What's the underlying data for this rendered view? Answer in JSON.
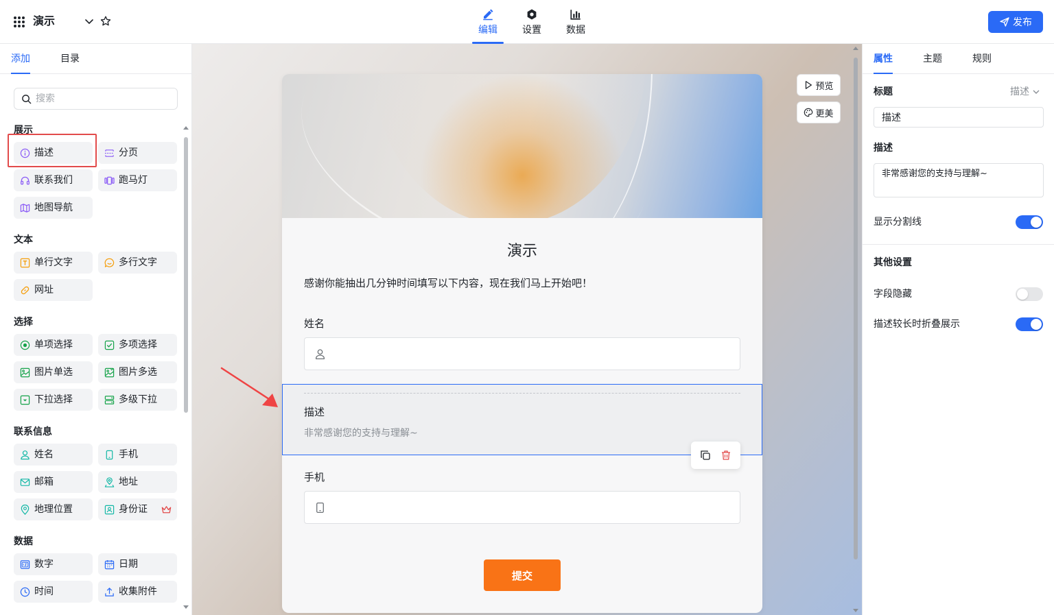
{
  "header": {
    "app_title": "演示",
    "tabs": [
      {
        "label": "编辑",
        "icon": "pencil-icon",
        "active": true
      },
      {
        "label": "设置",
        "icon": "gear-icon",
        "active": false
      },
      {
        "label": "数据",
        "icon": "bar-chart-icon",
        "active": false
      }
    ],
    "publish_label": "发布"
  },
  "left": {
    "tabs": [
      "添加",
      "目录"
    ],
    "search_placeholder": "搜索",
    "sections": {
      "display": "展示",
      "text": "文本",
      "choice": "选择",
      "contact": "联系信息",
      "data": "数据"
    },
    "items": {
      "describe": "描述",
      "pagination": "分页",
      "contact_us": "联系我们",
      "marquee": "跑马灯",
      "map_nav": "地图导航",
      "single_text": "单行文字",
      "multi_text": "多行文字",
      "url": "网址",
      "single_choice": "单项选择",
      "multi_choice": "多项选择",
      "image_single": "图片单选",
      "image_multi": "图片多选",
      "dropdown": "下拉选择",
      "cascade": "多级下拉",
      "name": "姓名",
      "phone": "手机",
      "email": "邮箱",
      "address": "地址",
      "location": "地理位置",
      "id_card": "身份证",
      "number": "数字",
      "date": "日期",
      "time": "时间",
      "attachment": "收集附件"
    }
  },
  "canvas": {
    "preview_label": "预览",
    "beautify_label": "更美",
    "form_title": "演示",
    "form_intro": "感谢你能抽出几分钟时间填写以下内容，现在我们马上开始吧！",
    "field_name_label": "姓名",
    "desc_title": "描述",
    "desc_text": "非常感谢您的支持与理解~",
    "field_phone_label": "手机",
    "submit_label": "提交"
  },
  "right": {
    "tabs": [
      "属性",
      "主题",
      "规则"
    ],
    "title_label": "标题",
    "title_type": "描述",
    "title_value": "描述",
    "desc_label": "描述",
    "desc_value": "非常感谢您的支持与理解~",
    "show_divider_label": "显示分割线",
    "show_divider": true,
    "other_settings_label": "其他设置",
    "hide_field_label": "字段隐藏",
    "hide_field": false,
    "fold_long_desc_label": "描述较长时折叠展示",
    "fold_long_desc": true
  },
  "colors": {
    "primary": "#2a6af6",
    "submit": "#f97316",
    "highlight": "#e24b4b"
  }
}
